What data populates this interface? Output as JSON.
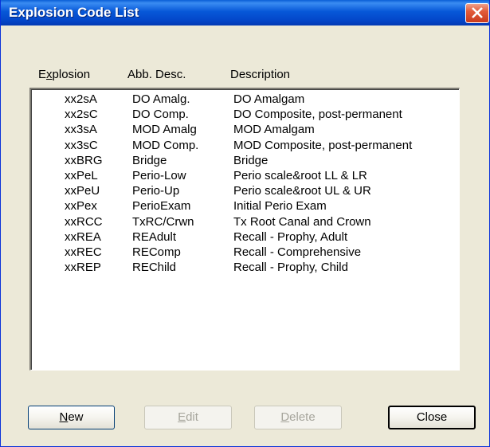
{
  "window": {
    "title": "Explosion Code List"
  },
  "columns": {
    "explosion": {
      "pre": "E",
      "ul": "x",
      "post": "plosion"
    },
    "abb_desc": "Abb. Desc.",
    "description": "Description"
  },
  "rows": [
    {
      "code": "xx2sA",
      "abb": "DO Amalg.",
      "desc": "DO Amalgam"
    },
    {
      "code": "xx2sC",
      "abb": "DO Comp.",
      "desc": "DO Composite, post-permanent"
    },
    {
      "code": "xx3sA",
      "abb": "MOD Amalg",
      "desc": "MOD Amalgam"
    },
    {
      "code": "xx3sC",
      "abb": "MOD Comp.",
      "desc": "MOD Composite, post-permanent"
    },
    {
      "code": "xxBRG",
      "abb": "Bridge",
      "desc": "Bridge"
    },
    {
      "code": "xxPeL",
      "abb": "Perio-Low",
      "desc": "Perio scale&root LL & LR"
    },
    {
      "code": "xxPeU",
      "abb": "Perio-Up",
      "desc": "Perio scale&root UL & UR"
    },
    {
      "code": "xxPex",
      "abb": "PerioExam",
      "desc": "Initial Perio Exam"
    },
    {
      "code": "xxRCC",
      "abb": "TxRC/Crwn",
      "desc": "Tx Root Canal and Crown"
    },
    {
      "code": "xxREA",
      "abb": "REAdult",
      "desc": "Recall - Prophy, Adult"
    },
    {
      "code": "xxREC",
      "abb": "REComp",
      "desc": "Recall - Comprehensive"
    },
    {
      "code": "xxREP",
      "abb": "REChild",
      "desc": "Recall - Prophy, Child"
    }
  ],
  "buttons": {
    "new": {
      "ul": "N",
      "rest": "ew",
      "enabled": true
    },
    "edit": {
      "ul": "E",
      "rest": "dit",
      "enabled": false
    },
    "delete": {
      "ul": "D",
      "rest": "elete",
      "enabled": false
    },
    "close": {
      "label": "Close",
      "enabled": true
    }
  },
  "colors": {
    "title_bar": "#0346c9",
    "face": "#ece9d8",
    "close_red": "#e25b3a"
  }
}
